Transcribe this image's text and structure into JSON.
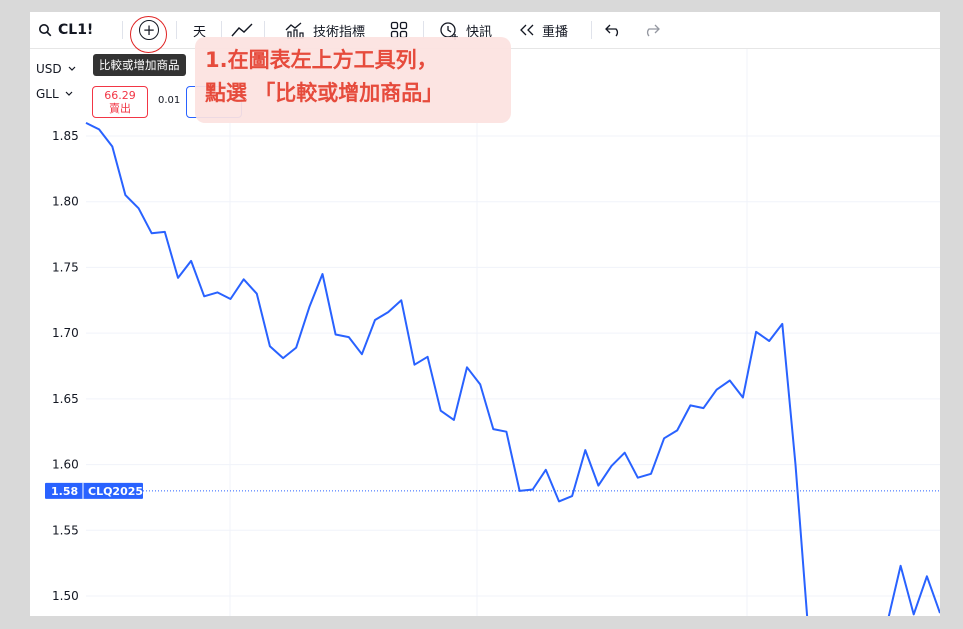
{
  "toolbar": {
    "symbol": "CL1!",
    "add_symbol_glyph": "+",
    "interval": "天",
    "indicators_label": "技術指標",
    "alerts_label": "快訊",
    "replay_label": "重播"
  },
  "tooltip": "比較或增加商品",
  "callout": {
    "line1": "1.在圖表左上方工具列，",
    "line2": "點選 「比較或增加商品」"
  },
  "left_panel": {
    "currency": "USD",
    "unit": "GLL",
    "sell_price": "66.29",
    "sell_label": "賣出",
    "spread": "0.01"
  },
  "price_tag": {
    "price": "1.58",
    "symbol": "CLQ2025"
  },
  "colors": {
    "line": "#2962ff",
    "accent_red": "#e02424",
    "callout_text": "#e64b3c",
    "callout_bg": "#fce2e0",
    "tooltip_bg": "#333333"
  },
  "icons": [
    "search-icon",
    "add-circle-icon",
    "line-chart-icon",
    "indicators-icon",
    "layout-grid-icon",
    "alert-clock-icon",
    "replay-icon",
    "undo-icon",
    "redo-icon",
    "chevron-down-icon"
  ],
  "chart_data": {
    "type": "line",
    "y_ticks": [
      "1.85",
      "1.80",
      "1.75",
      "1.70",
      "1.65",
      "1.60",
      "1.55",
      "1.50"
    ],
    "ylim": [
      1.48,
      1.88
    ],
    "series": [
      {
        "values": [
          1.86,
          1.855,
          1.842,
          1.805,
          1.795,
          1.776,
          1.777,
          1.742,
          1.755,
          1.728,
          1.731,
          1.726,
          1.741,
          1.73,
          1.69,
          1.681,
          1.689,
          1.72,
          1.745,
          1.699,
          1.697,
          1.684,
          1.71,
          1.716,
          1.725,
          1.676,
          1.682,
          1.641,
          1.634,
          1.674,
          1.661,
          1.627,
          1.625,
          1.58,
          1.581,
          1.596,
          1.572,
          1.576,
          1.611,
          1.584,
          1.599,
          1.609,
          1.59,
          1.593,
          1.62,
          1.626,
          1.645,
          1.643,
          1.657,
          1.664,
          1.651,
          1.701,
          1.694,
          1.707,
          1.6,
          1.47,
          1.462,
          1.465,
          1.468,
          1.464,
          1.47,
          1.48,
          1.523,
          1.486,
          1.515,
          1.487
        ]
      }
    ]
  }
}
